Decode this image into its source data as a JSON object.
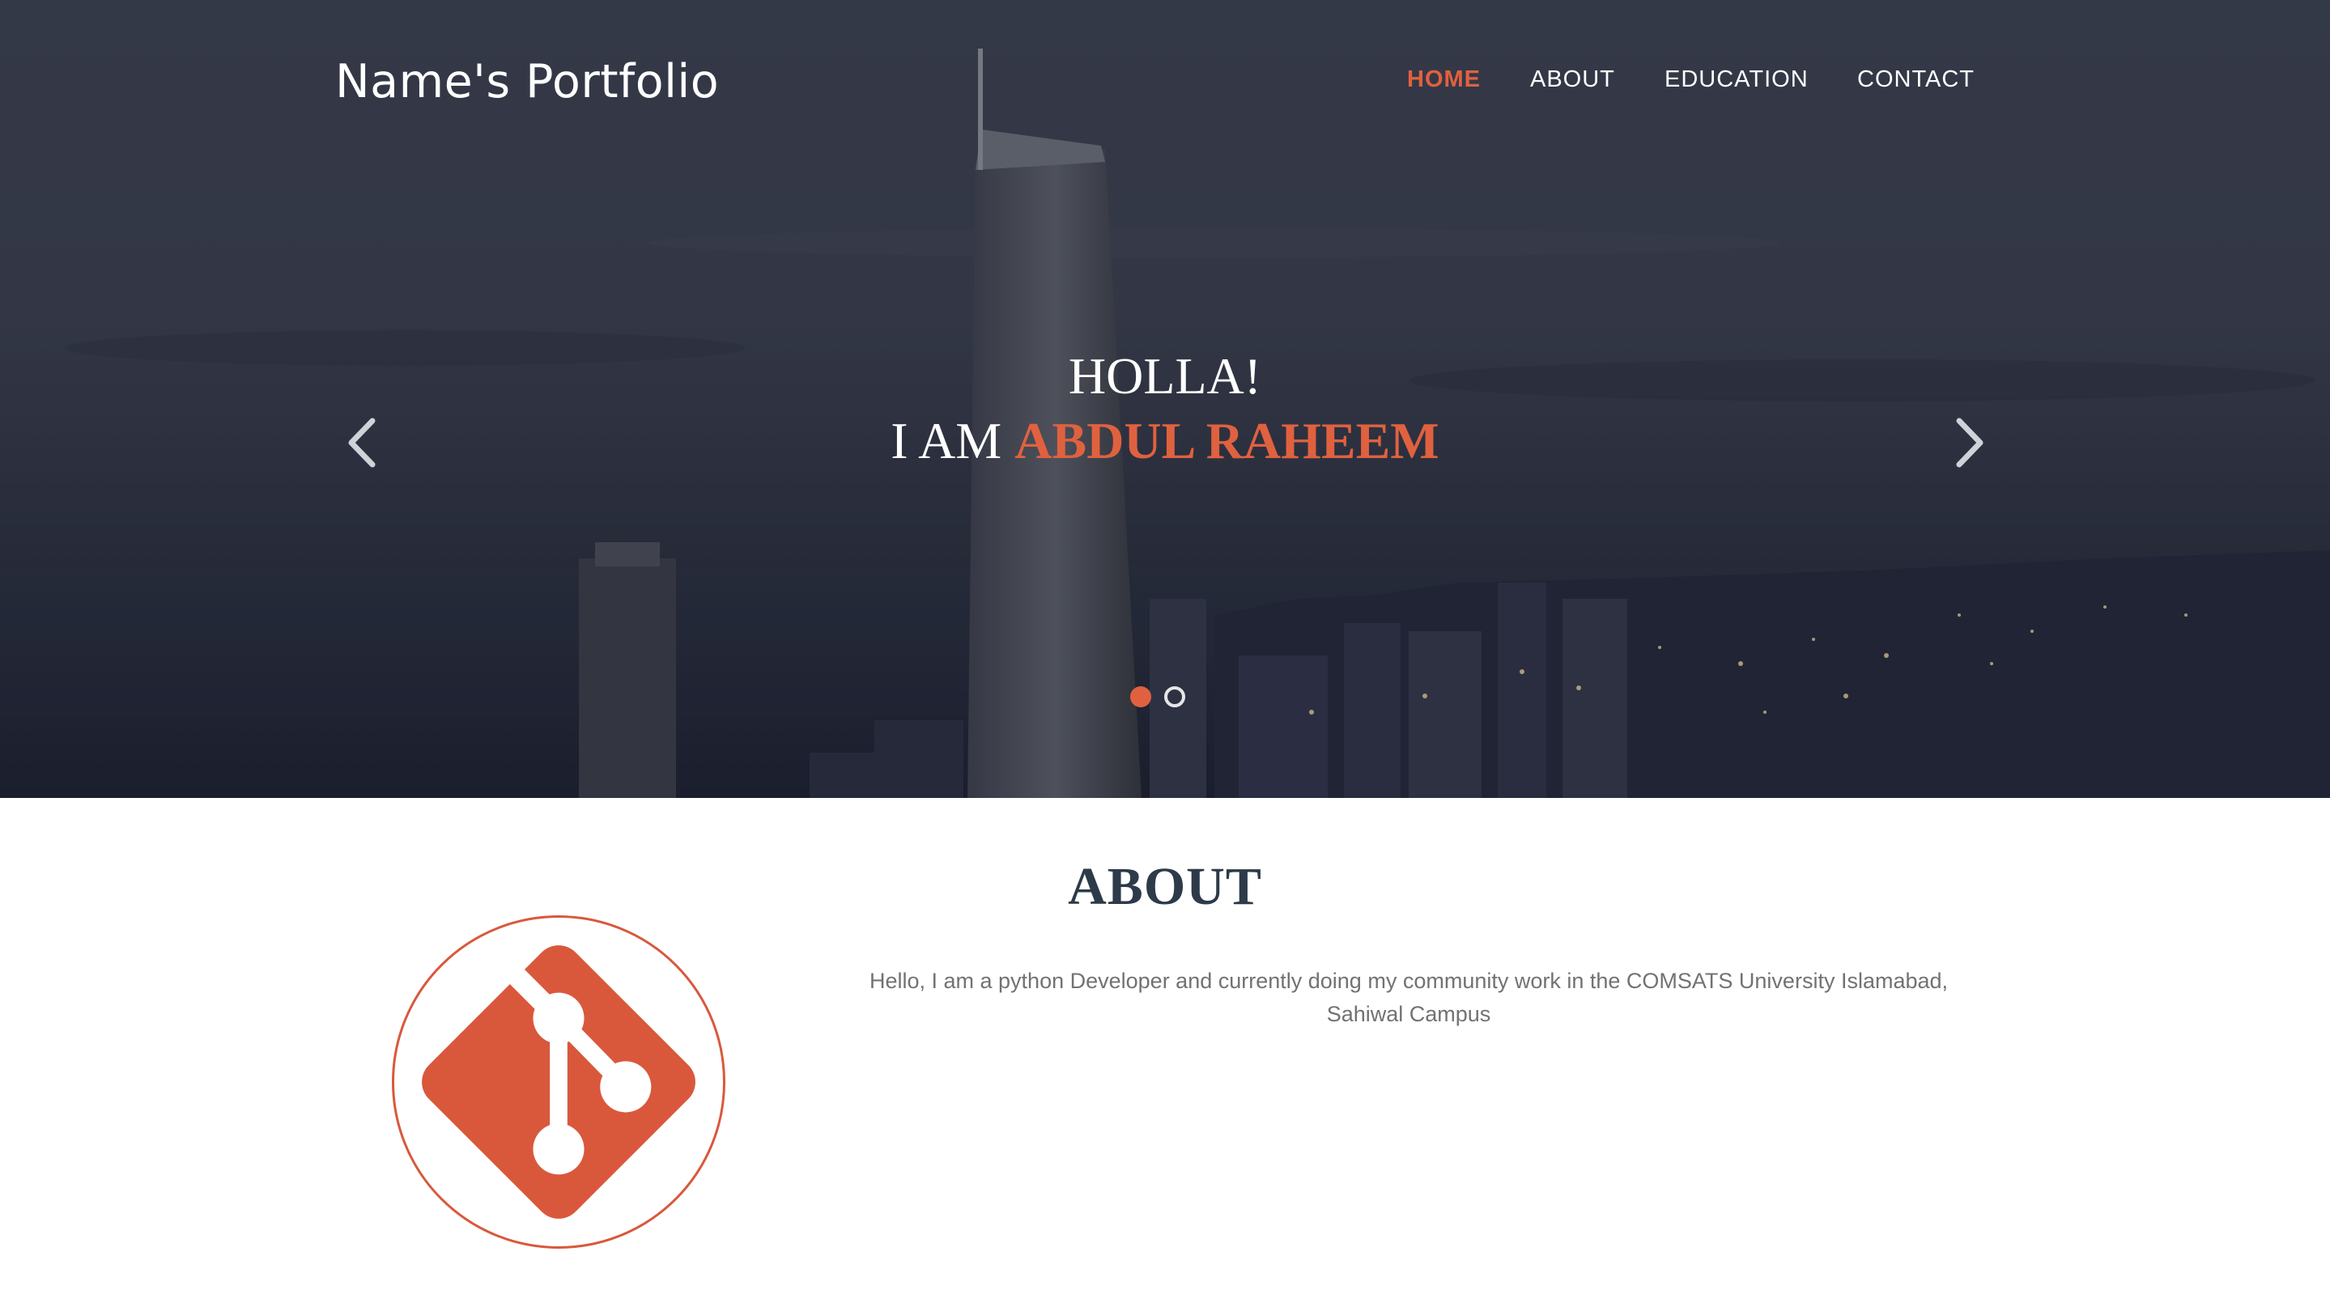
{
  "brand": {
    "title": "Name's Portfolio"
  },
  "nav": {
    "items": [
      {
        "label": "HOME",
        "active": true
      },
      {
        "label": "ABOUT",
        "active": false
      },
      {
        "label": "EDUCATION",
        "active": false
      },
      {
        "label": "CONTACT",
        "active": false
      }
    ]
  },
  "hero": {
    "greeting": "HOLLA!",
    "intro_prefix": "I AM ",
    "name": "ABDUL RAHEEM",
    "prev_icon": "chevron-left-icon",
    "next_icon": "chevron-right-icon",
    "slides_total": 2,
    "active_slide": 1
  },
  "about": {
    "title": "ABOUT",
    "logo_icon": "git-logo-icon",
    "text": "Hello, I am a python Developer and currently doing my community work in the COMSATS University Islamabad, Sahiwal Campus"
  },
  "colors": {
    "accent": "#e0613f",
    "heading": "#2c3a4a",
    "body_text": "#727272",
    "git_red": "#d9583c"
  }
}
